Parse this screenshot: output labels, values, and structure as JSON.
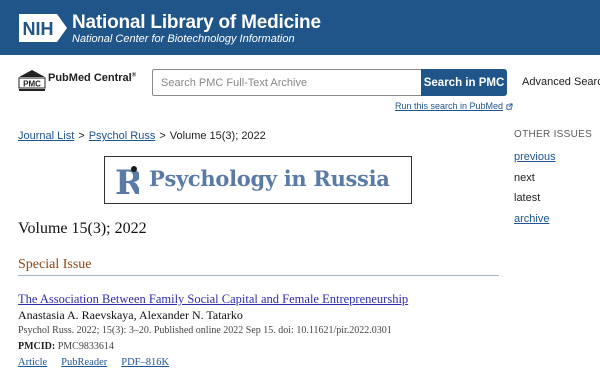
{
  "nih": {
    "logo_text": "NIH",
    "title": "National Library of Medicine",
    "subtitle": "National Center for Biotechnology Information"
  },
  "pmc": {
    "logo_mark": "PMC",
    "logo_text": "PubMed Central",
    "logo_reg": "®",
    "search_placeholder": "Search PMC Full-Text Archive",
    "search_button": "Search in PMC",
    "advanced_search": "Advanced Search",
    "pubmed_link": "Run this search in PubMed"
  },
  "breadcrumb": {
    "items": [
      "Journal List",
      "Psychol Russ"
    ],
    "separator": ">",
    "current": "Volume 15(3);  2022"
  },
  "journal": {
    "logo_letter": "R",
    "name": "Psychology in Russia"
  },
  "volume_title": "Volume 15(3);  2022",
  "section": {
    "heading": "Special Issue"
  },
  "article": {
    "title": "The Association Between Family Social Capital and Female Entrepreneurship",
    "authors": "Anastasia A. Raevskaya, Alexander N. Tatarko",
    "citation": "Psychol Russ. 2022; 15(3): 3–20. Published online 2022 Sep 15. doi: 10.11621/pir.2022.0301",
    "pmcid_label": "PMCID:",
    "pmcid_value": "PMC9833614",
    "links": [
      "Article",
      "PubReader",
      "PDF–816K"
    ]
  },
  "sidebar": {
    "heading": "OTHER ISSUES",
    "items": [
      "previous",
      "next",
      "latest",
      "archive"
    ]
  },
  "colors": {
    "nih_blue": "#20558a",
    "link_blue": "#205493",
    "section_brown": "#8b4513",
    "journal_blue": "#5a7aa8"
  }
}
